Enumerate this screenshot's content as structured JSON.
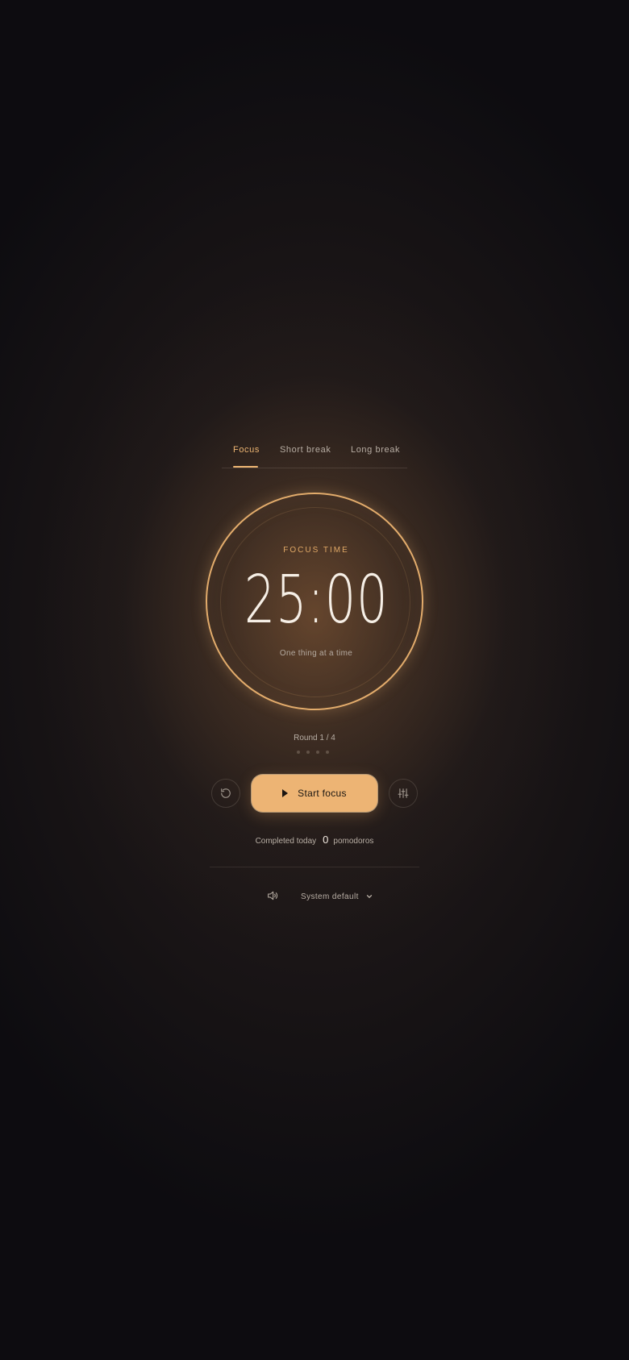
{
  "tabs": [
    {
      "label": "Focus",
      "active": true
    },
    {
      "label": "Short break",
      "active": false
    },
    {
      "label": "Long break",
      "active": false
    }
  ],
  "timer": {
    "mode_label": "FOCUS TIME",
    "time": "25:00",
    "subtitle": "One thing at a time"
  },
  "round": {
    "label": "Round 1 / 4",
    "total": 4
  },
  "controls": {
    "reset_icon": "reset-icon",
    "start_label": "Start focus",
    "start_icon": "play-icon",
    "settings_icon": "sliders-icon"
  },
  "completed": {
    "prefix": "Completed today",
    "count": "0",
    "suffix": "pomodoros"
  },
  "sound": {
    "icon": "speaker-icon",
    "selected": "System default",
    "chevron": "chevron-down-icon"
  },
  "colors": {
    "accent": "#eeb673",
    "background": "#0d0c10",
    "text_primary": "#f6efe6",
    "text_secondary": "#b9afa5"
  }
}
